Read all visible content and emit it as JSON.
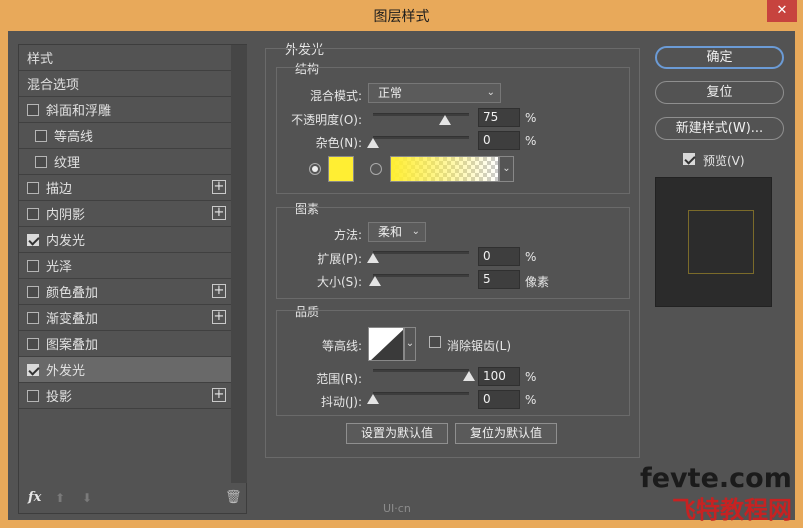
{
  "window": {
    "title": "图层样式",
    "close_glyph": "✕"
  },
  "left_panel": {
    "items": [
      {
        "label": "样式",
        "checkbox": false,
        "checked": false,
        "indent": 0,
        "plus": false,
        "selected": false
      },
      {
        "label": "混合选项",
        "checkbox": false,
        "checked": false,
        "indent": 0,
        "plus": false,
        "selected": false
      },
      {
        "label": "斜面和浮雕",
        "checkbox": true,
        "checked": false,
        "indent": 0,
        "plus": false,
        "selected": false
      },
      {
        "label": "等高线",
        "checkbox": true,
        "checked": false,
        "indent": 1,
        "plus": false,
        "selected": false
      },
      {
        "label": "纹理",
        "checkbox": true,
        "checked": false,
        "indent": 1,
        "plus": false,
        "selected": false
      },
      {
        "label": "描边",
        "checkbox": true,
        "checked": false,
        "indent": 0,
        "plus": true,
        "selected": false
      },
      {
        "label": "内阴影",
        "checkbox": true,
        "checked": false,
        "indent": 0,
        "plus": true,
        "selected": false
      },
      {
        "label": "内发光",
        "checkbox": true,
        "checked": true,
        "indent": 0,
        "plus": false,
        "selected": false
      },
      {
        "label": "光泽",
        "checkbox": true,
        "checked": false,
        "indent": 0,
        "plus": false,
        "selected": false
      },
      {
        "label": "颜色叠加",
        "checkbox": true,
        "checked": false,
        "indent": 0,
        "plus": true,
        "selected": false
      },
      {
        "label": "渐变叠加",
        "checkbox": true,
        "checked": false,
        "indent": 0,
        "plus": true,
        "selected": false
      },
      {
        "label": "图案叠加",
        "checkbox": true,
        "checked": false,
        "indent": 0,
        "plus": false,
        "selected": false
      },
      {
        "label": "外发光",
        "checkbox": true,
        "checked": true,
        "indent": 0,
        "plus": false,
        "selected": true
      },
      {
        "label": "投影",
        "checkbox": true,
        "checked": false,
        "indent": 0,
        "plus": true,
        "selected": false
      }
    ],
    "footer": {
      "fx": "fx",
      "up": "⬆",
      "down": "⬇",
      "trash": "🗑"
    }
  },
  "outer_glow": {
    "title": "外发光",
    "structure": {
      "title": "结构",
      "blend_mode_label": "混合模式:",
      "blend_mode_value": "正常",
      "opacity_label": "不透明度(O):",
      "opacity_value": "75",
      "opacity_pct": 75,
      "noise_label": "杂色(N):",
      "noise_value": "0",
      "noise_pct": 0,
      "percent": "%",
      "color_swatch": "#ffee33",
      "gradient_from": "#ffee33"
    },
    "elements": {
      "title": "图素",
      "technique_label": "方法:",
      "technique_value": "柔和",
      "spread_label": "扩展(P):",
      "spread_value": "0",
      "spread_pct": 0,
      "size_label": "大小(S):",
      "size_value": "5",
      "size_pct": 2,
      "percent": "%",
      "px_unit": "像素"
    },
    "quality": {
      "title": "品质",
      "contour_label": "等高线:",
      "antialias_label": "消除锯齿(L)",
      "range_label": "范围(R):",
      "range_value": "100",
      "range_pct": 100,
      "jitter_label": "抖动(J):",
      "jitter_value": "0",
      "jitter_pct": 0,
      "percent": "%"
    },
    "make_default": "设置为默认值",
    "reset_default": "复位为默认值"
  },
  "right_panel": {
    "ok": "确定",
    "reset": "复位",
    "new_style": "新建样式(W)...",
    "preview_label": "预览(V)",
    "preview_checked": true
  },
  "watermarks": {
    "site": "fevte.com",
    "site_cn": "飞特教程网",
    "small": "UI·cn"
  }
}
